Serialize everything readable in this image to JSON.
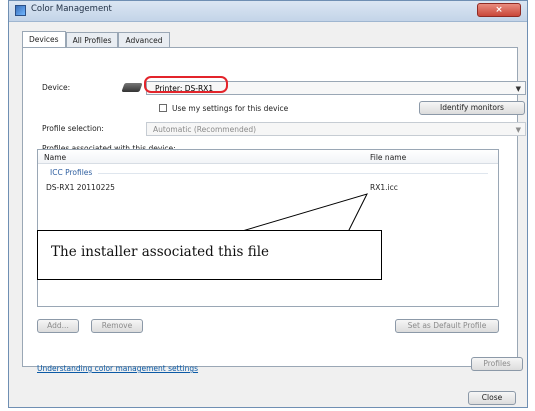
{
  "window": {
    "title": "Color Management"
  },
  "tabs": [
    {
      "label": "Devices",
      "active": true
    },
    {
      "label": "All Profiles",
      "active": false
    },
    {
      "label": "Advanced",
      "active": false
    }
  ],
  "device": {
    "label": "Device:",
    "selected": "Printer: DS-RX1",
    "use_my_settings_label": "Use my settings for this device",
    "identify_monitors_label": "Identify monitors"
  },
  "profile_selection": {
    "label": "Profile selection:",
    "value": "Automatic (Recommended)"
  },
  "profiles_associated_label": "Profiles associated with this device:",
  "profiles_table": {
    "columns": [
      "Name",
      "File name"
    ],
    "group": "ICC Profiles",
    "rows": [
      {
        "name": "DS-RX1 20110225",
        "file": "RX1.icc"
      }
    ]
  },
  "buttons": {
    "add": "Add...",
    "remove": "Remove",
    "set_default": "Set as Default Profile",
    "profiles": "Profiles",
    "close": "Close"
  },
  "help_link": "Understanding color management settings",
  "callout": {
    "text": "The installer associated this file"
  },
  "colors": {
    "highlight": "#e3242b",
    "link": "#0b5aa6"
  }
}
